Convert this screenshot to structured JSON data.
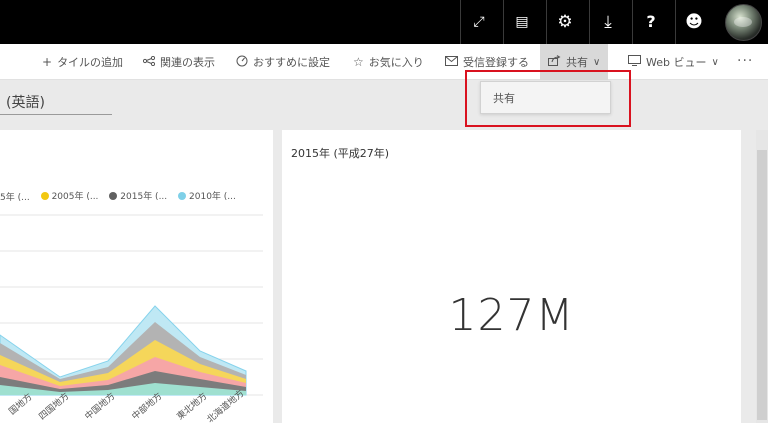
{
  "topbar": {
    "buttons": [
      {
        "icon": "expand-icon",
        "glyph": "⤢"
      },
      {
        "icon": "comment-icon",
        "glyph": "▤"
      },
      {
        "icon": "gear-icon",
        "glyph": "⚙"
      },
      {
        "icon": "download-icon",
        "glyph": "⤓"
      },
      {
        "icon": "help-icon",
        "glyph": "?"
      },
      {
        "icon": "smiley-icon",
        "glyph": "☻"
      }
    ]
  },
  "actions": {
    "add_tile": "タイルの追加",
    "related": "関連の表示",
    "featured": "おすすめに設定",
    "favorite": "お気に入り",
    "subscribe": "受信登録する",
    "share": "共有",
    "web_view": "Web ビュー",
    "more": "···"
  },
  "dropdown": {
    "share_item": "共有"
  },
  "title_field": {
    "value": "(英語)"
  },
  "tiles": {
    "right_title": "2015年 (平成27年)",
    "right_value": "127M"
  },
  "chart_data": {
    "type": "area",
    "series": [
      {
        "name": "5年 (...",
        "color": "#5bc0a8"
      },
      {
        "name": "2005年 (...",
        "color": "#f2c811"
      },
      {
        "name": "2015年 (...",
        "color": "#606060"
      },
      {
        "name": "2010年 (...",
        "color": "#7fd0e8"
      }
    ],
    "categories": [
      "国地方",
      "四国地方",
      "中国地方",
      "中部地方",
      "東北地方",
      "北海道地方"
    ],
    "legend_position": "top"
  },
  "colors": {
    "highlight": "#d9121f",
    "topbar": "#000000"
  }
}
